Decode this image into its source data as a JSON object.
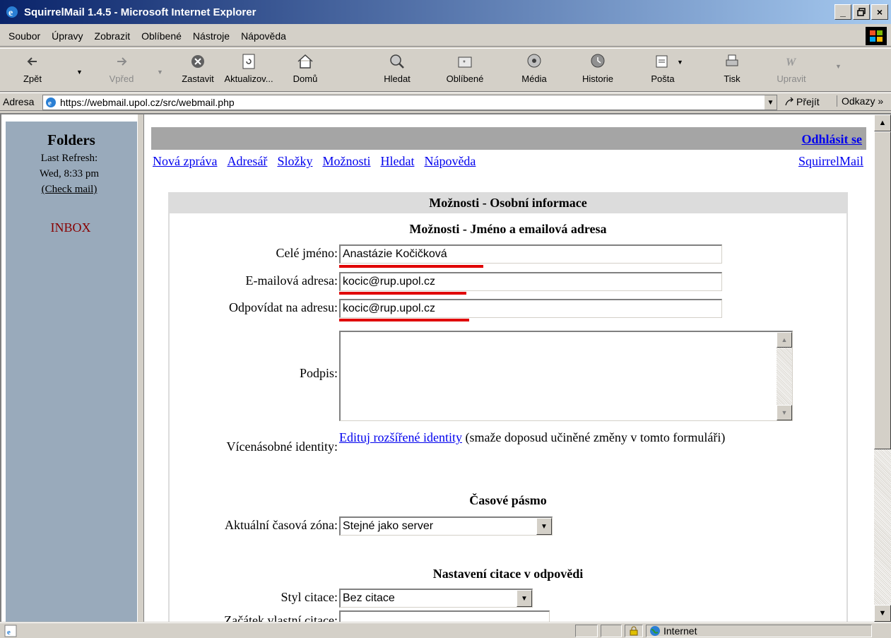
{
  "window": {
    "title": "SquirrelMail 1.4.5 - Microsoft Internet Explorer",
    "buttons": {
      "minimize": "_",
      "maximize": "Е",
      "close": "×"
    }
  },
  "menu": [
    "Soubor",
    "Úpravy",
    "Zobrazit",
    "Oblíbené",
    "Nástroje",
    "Nápověda"
  ],
  "toolbar": {
    "back": "Zpět",
    "forward": "Vpřed",
    "stop": "Zastavit",
    "refresh": "Aktualizov...",
    "home": "Domů",
    "search": "Hledat",
    "favorites": "Oblíbené",
    "media": "Média",
    "history": "Historie",
    "mail": "Pošta",
    "print": "Tisk",
    "edit": "Upravit"
  },
  "address": {
    "label": "Adresa",
    "url": "https://webmail.upol.cz/src/webmail.php",
    "go": "Přejít",
    "links": "Odkazy"
  },
  "left_frame": {
    "title": "Folders",
    "last_refresh_label": "Last Refresh:",
    "last_refresh_time": "Wed, 8:33 pm",
    "check_mail": "(Check mail)",
    "inbox": "INBOX"
  },
  "main": {
    "logout": "Odhlásit se",
    "nav": [
      "Nová zpráva",
      "Adresář",
      "Složky",
      "Možnosti",
      "Hledat",
      "Nápověda"
    ],
    "squirrelmail_link": "SquirrelMail",
    "options_header": "Možnosti - Osobní informace",
    "section_name_email": "Možnosti - Jméno a emailová adresa",
    "full_name_label": "Celé jméno:",
    "full_name_value": "Anastázie Kočičková",
    "email_label": "E-mailová adresa:",
    "email_value": "kocic@rup.upol.cz",
    "reply_to_label": "Odpovídat na adresu:",
    "reply_to_value": "kocic@rup.upol.cz",
    "signature_label": "Podpis:",
    "signature_value": "",
    "multi_identities_label": "Vícenásobné identity:",
    "multi_identities_link": "Edituj rozšířené identity",
    "multi_identities_note": " (smaže doposud učiněné změny v tomto formuláři)",
    "section_timezone": "Časové pásmo",
    "timezone_label": "Aktuální časová zóna:",
    "timezone_value": "Stejné jako server",
    "section_reply": "Nastavení citace v odpovědi",
    "citation_style_label": "Styl citace:",
    "citation_style_value": "Bez citace",
    "custom_citation_start_label": "Začátek vlastní citace:",
    "custom_citation_start_value": ""
  },
  "status": {
    "zone": "Internet"
  },
  "colors": {
    "left_frame_bg": "#99aabb",
    "top_strip_bg": "#a5a5a5",
    "header_bg": "#dcdcdc",
    "link": "#0000ee",
    "inbox": "#880000",
    "highlight_underline": "#e00000"
  }
}
